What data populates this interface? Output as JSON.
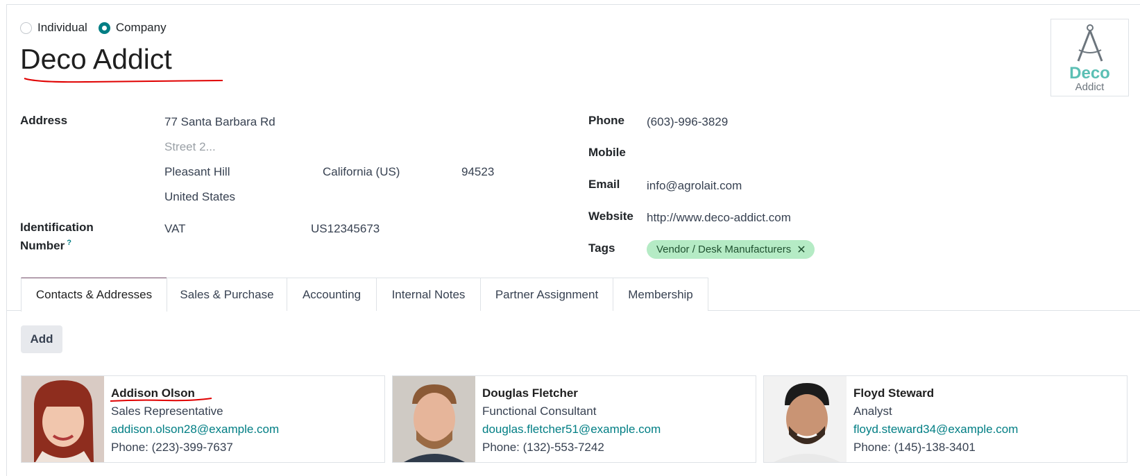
{
  "partner_type": {
    "individual_label": "Individual",
    "company_label": "Company",
    "selected": "Company"
  },
  "company_name": "Deco Addict",
  "logo": {
    "line1": "Deco",
    "line2": "Addict",
    "icon": "compass-icon"
  },
  "address": {
    "label": "Address",
    "street": "77 Santa Barbara Rd",
    "street2_placeholder": "Street 2...",
    "city": "Pleasant Hill",
    "state": "California (US)",
    "zip": "94523",
    "country": "United States"
  },
  "identification": {
    "label_line1": "Identification",
    "label_line2": "Number",
    "help": "?",
    "type": "VAT",
    "value": "US12345673"
  },
  "contact_info": {
    "phone_label": "Phone",
    "phone": "(603)-996-3829",
    "mobile_label": "Mobile",
    "mobile": "",
    "email_label": "Email",
    "email": "info@agrolait.com",
    "website_label": "Website",
    "website": "http://www.deco-addict.com",
    "tags_label": "Tags",
    "tags": [
      "Vendor / Desk Manufacturers"
    ],
    "tag_remove": "✕"
  },
  "tabs": [
    {
      "label": "Contacts & Addresses",
      "active": true
    },
    {
      "label": "Sales & Purchase",
      "active": false
    },
    {
      "label": "Accounting",
      "active": false
    },
    {
      "label": "Internal Notes",
      "active": false
    },
    {
      "label": "Partner Assignment",
      "active": false
    },
    {
      "label": "Membership",
      "active": false
    }
  ],
  "add_label": "Add",
  "contacts": [
    {
      "name": "Addison Olson",
      "role": "Sales Representative",
      "email": "addison.olson28@example.com",
      "phone": "Phone: (223)-399-7637"
    },
    {
      "name": "Douglas Fletcher",
      "role": "Functional Consultant",
      "email": "douglas.fletcher51@example.com",
      "phone": "Phone: (132)-553-7242"
    },
    {
      "name": "Floyd Steward",
      "role": "Analyst",
      "email": "floyd.steward34@example.com",
      "phone": "Phone: (145)-138-3401"
    }
  ],
  "colors": {
    "accent": "#017e84",
    "tab_active_border": "#714b67",
    "tag_bg": "#b5ebc5",
    "annotation": "#e00000"
  }
}
